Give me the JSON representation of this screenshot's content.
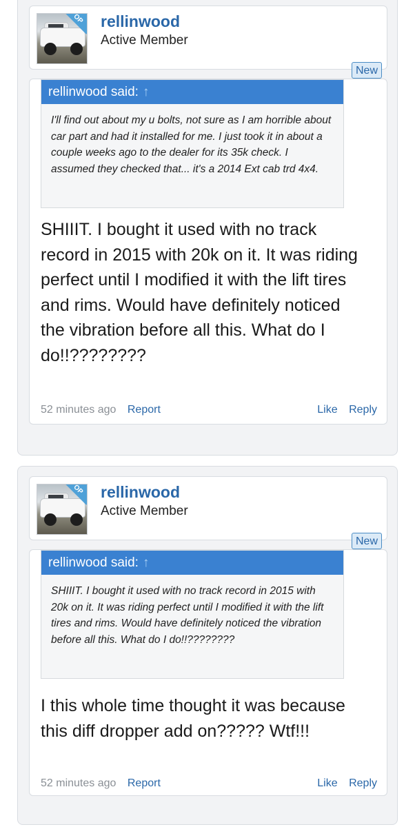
{
  "posts": [
    {
      "author": "rellinwood",
      "user_title": "Active Member",
      "op_badge": "OP",
      "new_badge": "New",
      "quote_author": "rellinwood said:",
      "quote_arrow": "↑",
      "quote_text": "I'll find out about my u bolts, not sure as I am horrible about car part and had it installed for me. I just took it in about a couple weeks ago to the dealer for its 35k check. I assumed they checked that... it's a 2014 Ext cab trd 4x4.",
      "body": "SHIIIT. I bought it used with no track record in 2015 with 20k on it. It was riding perfect until I modified it with the lift tires and rims. Would have definitely noticed the vibration before all this. What do I do!!????????",
      "time": "52 minutes ago",
      "report": "Report",
      "like": "Like",
      "reply": "Reply"
    },
    {
      "author": "rellinwood",
      "user_title": "Active Member",
      "op_badge": "OP",
      "new_badge": "New",
      "quote_author": "rellinwood said:",
      "quote_arrow": "↑",
      "quote_text": "SHIIIT. I bought it used with no track record in 2015 with 20k on it. It was riding perfect until I modified it with the lift tires and rims. Would have definitely noticed the vibration before all this. What do I do!!????????",
      "body": "I this whole time thought it was because this diff dropper add on????? Wtf!!!",
      "time": "52 minutes ago",
      "report": "Report",
      "like": "Like",
      "reply": "Reply"
    }
  ],
  "colors": {
    "link": "#2a67a8",
    "quote_header": "#3a81d1",
    "op_badge": "#4fa1d8",
    "timestamp": "#8a8f95"
  }
}
